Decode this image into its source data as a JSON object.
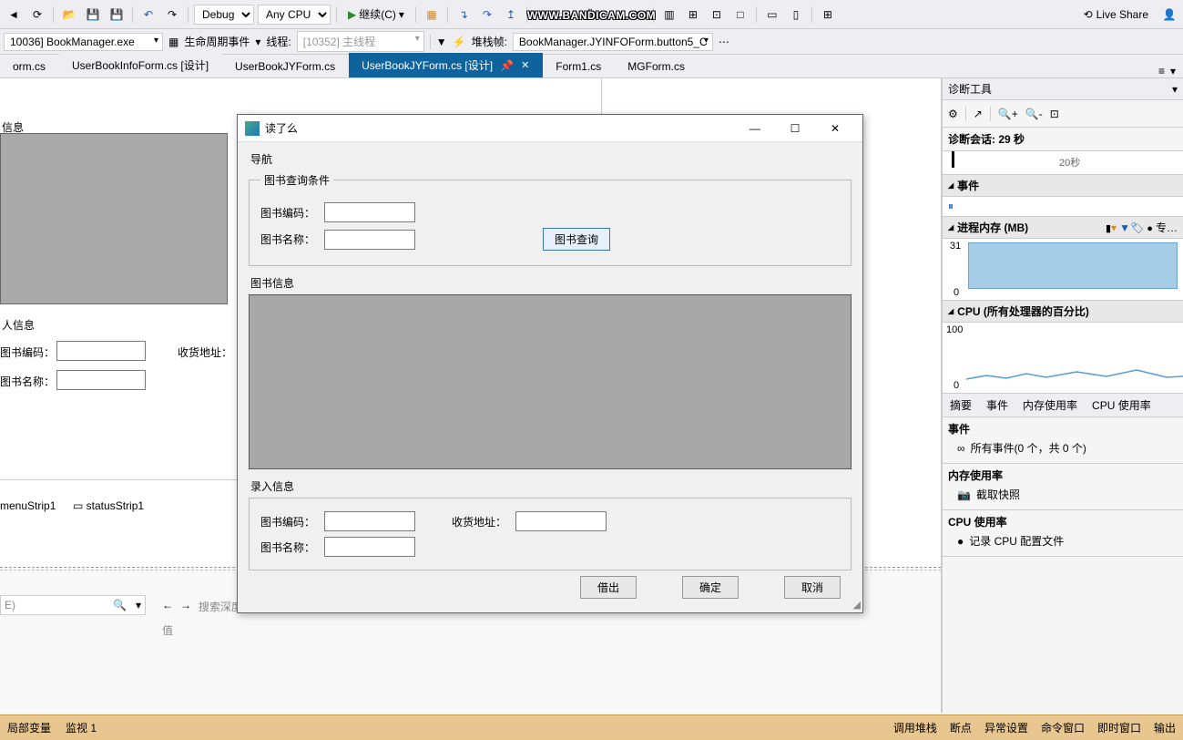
{
  "watermark": "WWW.BANDICAM.COM",
  "toolbar": {
    "config": "Debug",
    "platform": "Any CPU",
    "continue_label": "继续(C)",
    "liveshare": "Live Share"
  },
  "debugbar": {
    "process": "10036] BookManager.exe",
    "lifecycle": "生命周期事件",
    "thread_lbl": "线程:",
    "thread": "[10352] 主线程",
    "stack_lbl": "堆栈帧:",
    "stack": "BookManager.JYINFOForm.button5_C"
  },
  "tabs": [
    {
      "label": "orm.cs"
    },
    {
      "label": "UserBookInfoForm.cs [设计]"
    },
    {
      "label": "UserBookJYForm.cs"
    },
    {
      "label": "UserBookJYForm.cs [设计]",
      "active": true
    },
    {
      "label": "Form1.cs"
    },
    {
      "label": "MGForm.cs"
    }
  ],
  "designer": {
    "group1": "信息",
    "group2": "人信息",
    "lbl_code": "图书编码：",
    "lbl_name": "图书名称：",
    "lbl_addr": "收货地址：",
    "strip1": "menuStrip1",
    "strip2": "statusStrip1",
    "search_hint": "E)",
    "depth": "搜索深度",
    "local_vars": "局部变量",
    "watch": "监视 1",
    "value_col": "值"
  },
  "dialog": {
    "title": "读了么",
    "nav": "导航",
    "grp_query": "图书查询条件",
    "lbl_code": "图书编码：",
    "lbl_name": "图书名称：",
    "btn_search": "图书查询",
    "grp_info": "图书信息",
    "grp_input": "录入信息",
    "lbl_addr": "收货地址：",
    "btn_borrow": "借出",
    "btn_ok": "确定",
    "btn_cancel": "取消"
  },
  "diag": {
    "title": "诊断工具",
    "session": "诊断会话: 29 秒",
    "timeline_mark": "20秒",
    "events": "事件",
    "mem_title": "进程内存 (MB)",
    "mem_markers": "专…",
    "mem_max": "31",
    "mem_min": "0",
    "cpu_title": "CPU (所有处理器的百分比)",
    "cpu_max": "100",
    "cpu_min": "0",
    "tabs": [
      "摘要",
      "事件",
      "内存使用率",
      "CPU 使用率"
    ],
    "events_section": "事件",
    "events_all": "所有事件(0 个，共 0 个)",
    "mem_section": "内存使用率",
    "mem_snapshot": "截取快照",
    "cpu_section": "CPU 使用率",
    "cpu_record": "记录 CPU 配置文件"
  },
  "status": {
    "left1": "局部变量",
    "left2": "监视 1",
    "r1": "调用堆栈",
    "r2": "断点",
    "r3": "异常设置",
    "r4": "命令窗口",
    "r5": "即时窗口",
    "r6": "输出"
  },
  "chart_data": [
    {
      "type": "area",
      "title": "进程内存 (MB)",
      "ylim": [
        0,
        31
      ],
      "x": [
        0,
        29
      ],
      "values": [
        31,
        31
      ],
      "note": "flat memory usage ~31 MB over session"
    },
    {
      "type": "line",
      "title": "CPU (所有处理器的百分比)",
      "ylim": [
        0,
        100
      ],
      "x": [
        0,
        5,
        10,
        15,
        20,
        25,
        29
      ],
      "values": [
        2,
        5,
        3,
        8,
        4,
        6,
        3
      ],
      "note": "low CPU activity with small spikes"
    }
  ]
}
